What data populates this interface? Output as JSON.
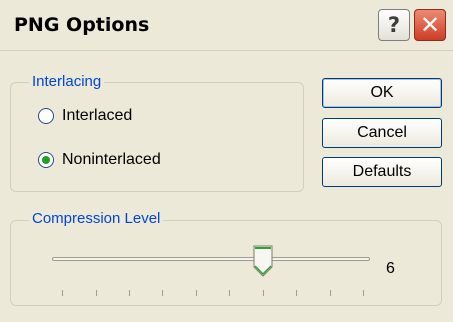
{
  "window": {
    "title": "PNG Options"
  },
  "titlebar_buttons": {
    "help": "?",
    "close": "✕"
  },
  "interlacing": {
    "group_title": "Interlacing",
    "options": [
      {
        "label": "Interlaced",
        "checked": false
      },
      {
        "label": "Noninterlaced",
        "checked": true
      }
    ]
  },
  "buttons": {
    "ok": "OK",
    "cancel": "Cancel",
    "defaults": "Defaults"
  },
  "compression": {
    "group_title": "Compression Level",
    "value": "6",
    "min": 0,
    "max": 9
  },
  "icons": {
    "help": "help-icon",
    "close": "close-icon",
    "thumb": "slider-thumb"
  },
  "colors": {
    "group_title": "#0046d5",
    "close_button": "#cf3d25",
    "radio_dot": "#21a121"
  }
}
